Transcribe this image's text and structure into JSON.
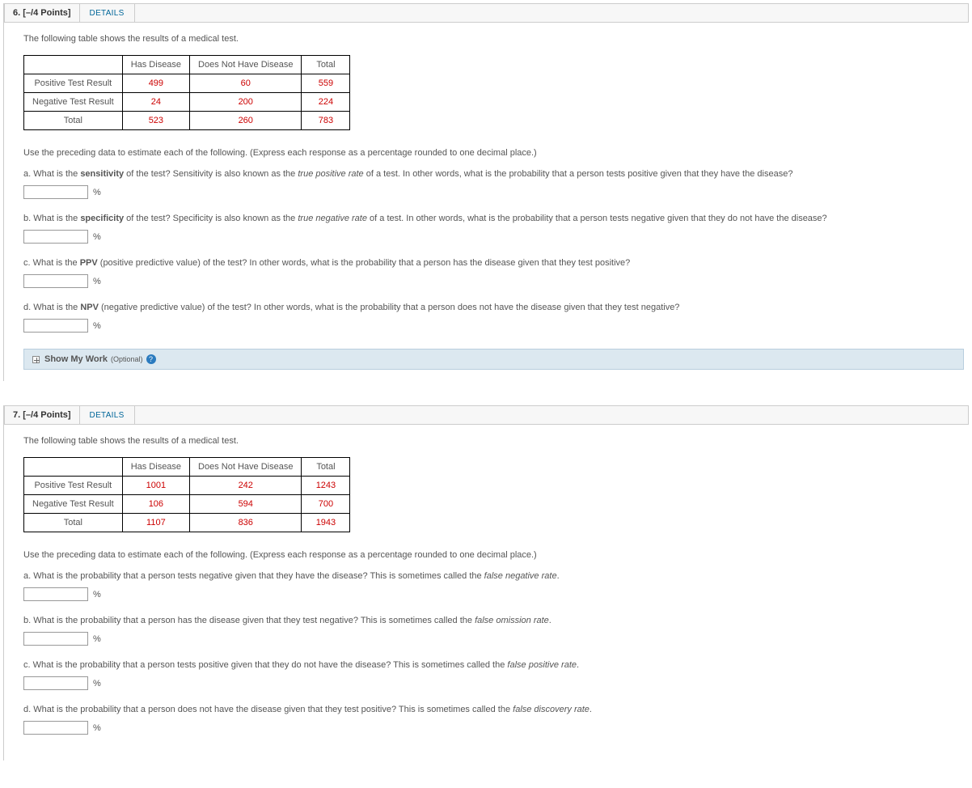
{
  "q6": {
    "number": "6.",
    "points": "[–/4 Points]",
    "details_label": "DETAILS",
    "intro": "The following table shows the results of a medical test.",
    "table": {
      "headers": [
        "",
        "Has Disease",
        "Does Not Have Disease",
        "Total"
      ],
      "rows": [
        {
          "label": "Positive Test Result",
          "vals": [
            "499",
            "60",
            "559"
          ]
        },
        {
          "label": "Negative Test Result",
          "vals": [
            "24",
            "200",
            "224"
          ]
        },
        {
          "label": "Total",
          "vals": [
            "523",
            "260",
            "783"
          ]
        }
      ]
    },
    "instruction": "Use the preceding data to estimate each of the following. (Express each response as a percentage rounded to one decimal place.)",
    "parts": {
      "a_pre": "a. What is the ",
      "a_bold": "sensitivity",
      "a_mid": " of the test? Sensitivity is also known as the ",
      "a_term": "true positive rate",
      "a_post": " of a test. In other words, what is the probability that a person tests positive given that they have the disease?",
      "b_pre": "b. What is the ",
      "b_bold": "specificity",
      "b_mid": " of the test? Specificity is also known as the ",
      "b_term": "true negative rate",
      "b_post": " of a test. In other words, what is the probability that a person tests negative given that they do not have the disease?",
      "c_pre": "c. What is the ",
      "c_bold": "PPV",
      "c_post": " (positive predictive value) of the test? In other words, what is the probability that a person has the disease given that they test positive?",
      "d_pre": "d. What is the ",
      "d_bold": "NPV",
      "d_post": " (negative predictive value) of the test? In other words, what is the probability that a person does not have the disease given that they test negative?"
    },
    "unit": "%",
    "show_work": "Show My Work",
    "show_work_opt": "(Optional)"
  },
  "q7": {
    "number": "7.",
    "points": "[–/4 Points]",
    "details_label": "DETAILS",
    "intro": "The following table shows the results of a medical test.",
    "table": {
      "headers": [
        "",
        "Has Disease",
        "Does Not Have Disease",
        "Total"
      ],
      "rows": [
        {
          "label": "Positive Test Result",
          "vals": [
            "1001",
            "242",
            "1243"
          ]
        },
        {
          "label": "Negative Test Result",
          "vals": [
            "106",
            "594",
            "700"
          ]
        },
        {
          "label": "Total",
          "vals": [
            "1107",
            "836",
            "1943"
          ]
        }
      ]
    },
    "instruction": "Use the preceding data to estimate each of the following. (Express each response as a percentage rounded to one decimal place.)",
    "parts": {
      "a_pre": "a. What is the probability that a person tests negative given that they have the disease? This is sometimes called the ",
      "a_term": "false negative rate",
      "a_post": ".",
      "b_pre": "b. What is the probability that a person has the disease given that they test negative? This is sometimes called the ",
      "b_term": "false omission rate",
      "b_post": ".",
      "c_pre": "c. What is the probability that a person tests positive given that they do not have the disease? This is sometimes called the ",
      "c_term": "false positive rate",
      "c_post": ".",
      "d_pre": "d. What is the probability that a person does not have the disease given that they test positive? This is sometimes called the ",
      "d_term": "false discovery rate",
      "d_post": "."
    },
    "unit": "%"
  }
}
